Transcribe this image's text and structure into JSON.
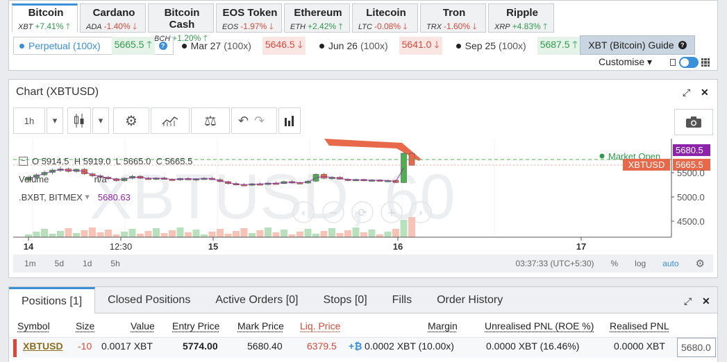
{
  "coins": [
    {
      "name": "Bitcoin",
      "symbol": "XBT",
      "change": "+7.41%",
      "dir": "up",
      "active": true
    },
    {
      "name": "Cardano",
      "symbol": "ADA",
      "change": "-1.40%",
      "dir": "down"
    },
    {
      "name": "Bitcoin Cash",
      "symbol": "BCH",
      "change": "+1.20%",
      "dir": "up"
    },
    {
      "name": "EOS Token",
      "symbol": "EOS",
      "change": "-1.97%",
      "dir": "down"
    },
    {
      "name": "Ethereum",
      "symbol": "ETH",
      "change": "+2.42%",
      "dir": "up"
    },
    {
      "name": "Litecoin",
      "symbol": "LTC",
      "change": "-0.08%",
      "dir": "down"
    },
    {
      "name": "Tron",
      "symbol": "TRX",
      "change": "-1.60%",
      "dir": "down"
    },
    {
      "name": "Ripple",
      "symbol": "XRP",
      "change": "+4.83%",
      "dir": "up"
    }
  ],
  "contracts": [
    {
      "name": "Perpetual",
      "leverage": "(100x)",
      "price": "5665.5",
      "dir": "up",
      "active": true
    },
    {
      "name": "Mar 27",
      "leverage": "(100x)",
      "price": "5646.5",
      "dir": "down"
    },
    {
      "name": "Jun 26",
      "leverage": "(100x)",
      "price": "5641.0",
      "dir": "down"
    },
    {
      "name": "Sep 25",
      "leverage": "(100x)",
      "price": "5687.5",
      "dir": "up"
    }
  ],
  "guide_label": "XBT (Bitcoin) Guide",
  "customise_label": "Customise",
  "chart": {
    "title": "Chart (XBTUSD)",
    "interval": "1h",
    "watermark": "XBTUSD, 60",
    "ohlc": {
      "o": "5914.5",
      "h": "5919.0",
      "l": "5665.0",
      "c": "5665.5"
    },
    "volume_label": "Volume",
    "volume_value": "n/a",
    "index_label": ".BXBT, BITMEX",
    "index_value": "5680.63",
    "market_status": "Market Open",
    "price_tags": [
      {
        "label": "",
        "value": "5680.5",
        "color": "#8e24aa"
      },
      {
        "label": "XBTUSD",
        "value": "5665.5",
        "color": "#e8694a"
      }
    ],
    "yticks": [
      "5500.0",
      "5000.0",
      "4500.0"
    ],
    "xticks": [
      "14",
      "12:30",
      "15",
      "16",
      "17"
    ],
    "intervals": [
      "1m",
      "5d",
      "1d",
      "5h"
    ],
    "clock": "03:37:33 (UTC+5:30)",
    "bottom_opts": [
      "%",
      "log",
      "auto"
    ]
  },
  "chart_data": {
    "type": "candlestick",
    "title": "XBTUSD, 60",
    "x_ticks": [
      "14",
      "12:30",
      "15",
      "16",
      "17"
    ],
    "y_ticks": [
      5500.0,
      5000.0,
      4500.0
    ],
    "ohlc_last": {
      "open": 5914.5,
      "high": 5919.0,
      "low": 5665.0,
      "close": 5665.5
    },
    "candles": [
      {
        "o": 5360,
        "h": 5450,
        "l": 5310,
        "c": 5420
      },
      {
        "o": 5420,
        "h": 5500,
        "l": 5380,
        "c": 5470
      },
      {
        "o": 5470,
        "h": 5560,
        "l": 5440,
        "c": 5520
      },
      {
        "o": 5520,
        "h": 5600,
        "l": 5480,
        "c": 5570
      },
      {
        "o": 5570,
        "h": 5640,
        "l": 5530,
        "c": 5590
      },
      {
        "o": 5590,
        "h": 5620,
        "l": 5520,
        "c": 5540
      },
      {
        "o": 5540,
        "h": 5600,
        "l": 5510,
        "c": 5585
      },
      {
        "o": 5585,
        "h": 5610,
        "l": 5470,
        "c": 5490
      },
      {
        "o": 5490,
        "h": 5520,
        "l": 5420,
        "c": 5450
      },
      {
        "o": 5450,
        "h": 5480,
        "l": 5400,
        "c": 5420
      },
      {
        "o": 5420,
        "h": 5450,
        "l": 5360,
        "c": 5390
      },
      {
        "o": 5390,
        "h": 5410,
        "l": 5330,
        "c": 5350
      },
      {
        "o": 5350,
        "h": 5420,
        "l": 5330,
        "c": 5400
      },
      {
        "o": 5400,
        "h": 5470,
        "l": 5380,
        "c": 5440
      },
      {
        "o": 5440,
        "h": 5460,
        "l": 5380,
        "c": 5400
      },
      {
        "o": 5400,
        "h": 5430,
        "l": 5370,
        "c": 5390
      },
      {
        "o": 5390,
        "h": 5420,
        "l": 5360,
        "c": 5405
      },
      {
        "o": 5405,
        "h": 5430,
        "l": 5370,
        "c": 5380
      },
      {
        "o": 5380,
        "h": 5400,
        "l": 5350,
        "c": 5370
      },
      {
        "o": 5370,
        "h": 5410,
        "l": 5350,
        "c": 5395
      },
      {
        "o": 5395,
        "h": 5420,
        "l": 5360,
        "c": 5375
      },
      {
        "o": 5375,
        "h": 5400,
        "l": 5340,
        "c": 5390
      },
      {
        "o": 5390,
        "h": 5420,
        "l": 5370,
        "c": 5400
      },
      {
        "o": 5400,
        "h": 5430,
        "l": 5360,
        "c": 5370
      },
      {
        "o": 5370,
        "h": 5400,
        "l": 5320,
        "c": 5330
      },
      {
        "o": 5330,
        "h": 5350,
        "l": 5270,
        "c": 5290
      },
      {
        "o": 5290,
        "h": 5320,
        "l": 5250,
        "c": 5270
      },
      {
        "o": 5270,
        "h": 5300,
        "l": 5240,
        "c": 5260
      },
      {
        "o": 5260,
        "h": 5300,
        "l": 5240,
        "c": 5285
      },
      {
        "o": 5285,
        "h": 5310,
        "l": 5260,
        "c": 5275
      },
      {
        "o": 5275,
        "h": 5320,
        "l": 5260,
        "c": 5300
      },
      {
        "o": 5300,
        "h": 5330,
        "l": 5270,
        "c": 5290
      },
      {
        "o": 5290,
        "h": 5350,
        "l": 5280,
        "c": 5330
      },
      {
        "o": 5330,
        "h": 5360,
        "l": 5290,
        "c": 5310
      },
      {
        "o": 5310,
        "h": 5330,
        "l": 5280,
        "c": 5300
      },
      {
        "o": 5300,
        "h": 5360,
        "l": 5290,
        "c": 5340
      },
      {
        "o": 5340,
        "h": 5500,
        "l": 5320,
        "c": 5480
      },
      {
        "o": 5480,
        "h": 5510,
        "l": 5380,
        "c": 5400
      },
      {
        "o": 5400,
        "h": 5440,
        "l": 5370,
        "c": 5420
      },
      {
        "o": 5420,
        "h": 5440,
        "l": 5370,
        "c": 5380
      },
      {
        "o": 5380,
        "h": 5400,
        "l": 5340,
        "c": 5360
      },
      {
        "o": 5360,
        "h": 5390,
        "l": 5340,
        "c": 5375
      },
      {
        "o": 5375,
        "h": 5390,
        "l": 5340,
        "c": 5350
      },
      {
        "o": 5350,
        "h": 5380,
        "l": 5330,
        "c": 5365
      },
      {
        "o": 5365,
        "h": 5380,
        "l": 5330,
        "c": 5345
      },
      {
        "o": 5345,
        "h": 5370,
        "l": 5320,
        "c": 5355
      },
      {
        "o": 5355,
        "h": 5370,
        "l": 5300,
        "c": 5310
      },
      {
        "o": 5310,
        "h": 5930,
        "l": 5300,
        "c": 5914.5
      },
      {
        "o": 5914.5,
        "h": 5919.0,
        "l": 5665.0,
        "c": 5665.5
      }
    ]
  },
  "positions": {
    "tabs": [
      "Positions [1]",
      "Closed Positions",
      "Active Orders [0]",
      "Stops [0]",
      "Fills",
      "Order History"
    ],
    "headers": [
      "Symbol",
      "Size",
      "Value",
      "Entry Price",
      "Mark Price",
      "Liq. Price",
      "Margin",
      "Unrealised PNL (ROE %)",
      "Realised PNL"
    ],
    "row": {
      "symbol": "XBTUSD",
      "size": "-10",
      "value": "0.0017 XBT",
      "entry_price": "5774.00",
      "mark_price": "5680.40",
      "liq_price": "6379.5",
      "margin_prefix": "+₿",
      "margin": "0.0002 XBT (10.00x)",
      "unrealised": "0.0000 XBT (16.46%)",
      "realised": "0.0000 XBT",
      "close_price": "5680.0"
    }
  },
  "colors": {
    "up": "#2f9a4e",
    "down": "#d6493a",
    "accent": "#3a8fd9",
    "candle_up": "#4caf50",
    "candle_down": "#e8694a"
  }
}
